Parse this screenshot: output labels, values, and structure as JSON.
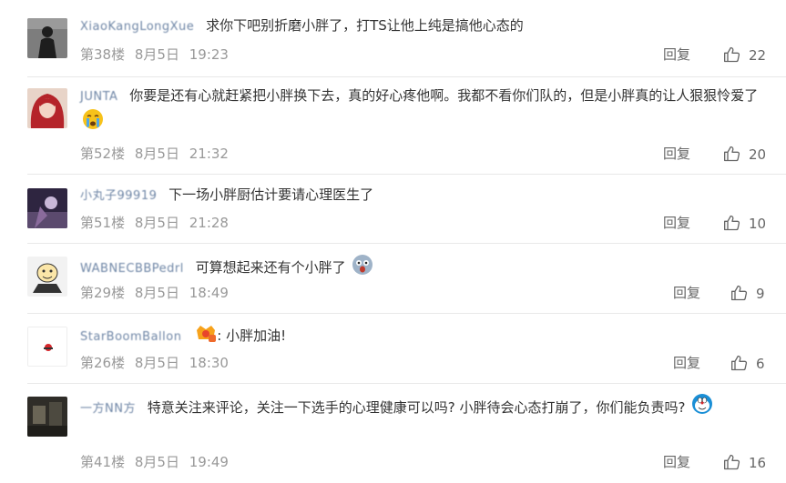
{
  "reply_label": "回复",
  "comments": [
    {
      "username": "XiaoKangLongXue",
      "text": "求你下吧别折磨小胖了，打TS让他上纯是搞他心态的",
      "floor": "第38楼",
      "date": "8月5日",
      "time": "19:23",
      "likes": "22",
      "avatar_color": "#5a5a5a"
    },
    {
      "username": "JUNTA",
      "text": "你要是还有心就赶紧把小胖换下去，真的好心疼他啊。我都不看你们队的，但是小胖真的让人狠狠怜爱了",
      "floor": "第52楼",
      "date": "8月5日",
      "time": "21:32",
      "likes": "20",
      "avatar_color": "#c0392b"
    },
    {
      "username": "小丸子99919",
      "text": "下一场小胖厨估计要请心理医生了",
      "floor": "第51楼",
      "date": "8月5日",
      "time": "21:28",
      "likes": "10",
      "avatar_color": "#4a3b5e"
    },
    {
      "username": "WABNECBBPedrl",
      "text": "可算想起来还有个小胖了",
      "floor": "第29楼",
      "date": "8月5日",
      "time": "18:49",
      "likes": "9",
      "avatar_color": "#dddddd"
    },
    {
      "username": "StarBoomBallon",
      "text": "小胖加油!",
      "floor": "第26楼",
      "date": "8月5日",
      "time": "18:30",
      "likes": "6",
      "avatar_color": "#ffffff"
    },
    {
      "username": "一方NN方",
      "text": "特意关注来评论，关注一下选手的心理健康可以吗? 小胖待会心态打崩了，你们能负责吗?",
      "floor": "第41楼",
      "date": "8月5日",
      "time": "19:49",
      "likes": "16",
      "avatar_color": "#3e3c36"
    }
  ]
}
